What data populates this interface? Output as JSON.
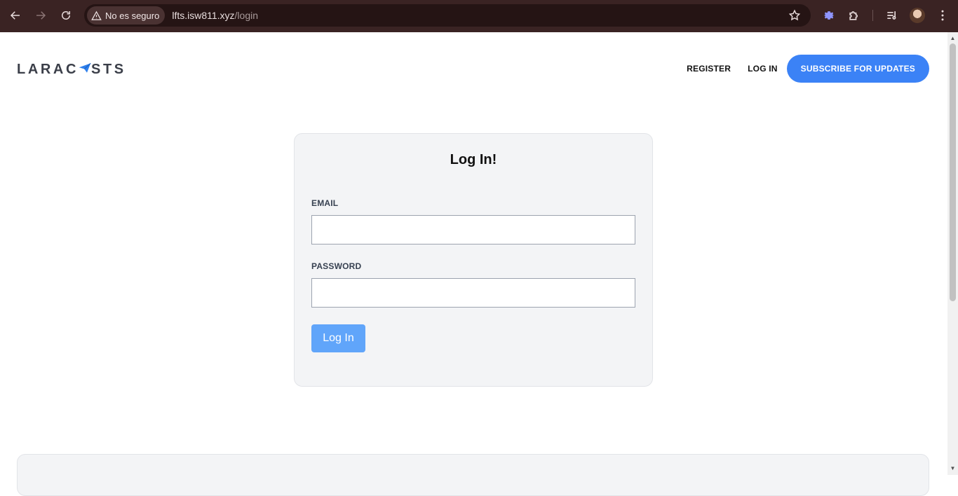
{
  "browser": {
    "security_label": "No es seguro",
    "url_host": "lfts.isw811.xyz",
    "url_path": "/login",
    "icons": {
      "back": "arrow-left-icon",
      "forward": "arrow-right-icon",
      "reload": "reload-icon",
      "warning": "warning-icon",
      "bookmark": "star-icon",
      "settings": "gear-icon",
      "extensions": "puzzle-icon",
      "media": "media-control-icon",
      "profile": "profile-avatar",
      "menu": "kebab-menu-icon"
    }
  },
  "site": {
    "logo_text_left": "LARAC",
    "logo_text_right": "STS",
    "nav": {
      "register": "REGISTER",
      "login": "LOG IN",
      "subscribe": "SUBSCRIBE FOR UPDATES"
    }
  },
  "login_form": {
    "title": "Log In!",
    "email_label": "EMAIL",
    "email_value": "",
    "password_label": "PASSWORD",
    "password_value": "",
    "submit_label": "Log In"
  },
  "colors": {
    "chrome_bg": "#3a2323",
    "accent": "#3b82f6",
    "button_light": "#60a5fa",
    "card_bg": "#f3f4f6"
  }
}
